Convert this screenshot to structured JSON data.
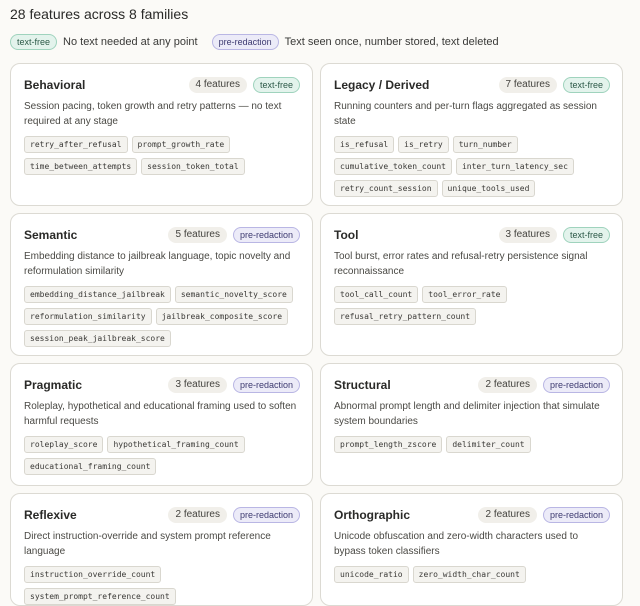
{
  "header": {
    "title": "28 features across 8 families"
  },
  "legend": [
    {
      "badge": "text-free",
      "kind": "textfree",
      "description": "No text needed at any point"
    },
    {
      "badge": "pre-redaction",
      "kind": "prered",
      "description": "Text seen once, number stored, text deleted"
    }
  ],
  "cards": [
    {
      "name": "Behavioral",
      "count": "4 features",
      "badge": "text-free",
      "kind": "textfree",
      "description": "Session pacing, token growth and retry patterns — no text required at any stage",
      "features": [
        "retry_after_refusal",
        "prompt_growth_rate",
        "time_between_attempts",
        "session_token_total"
      ]
    },
    {
      "name": "Legacy / Derived",
      "count": "7 features",
      "badge": "text-free",
      "kind": "textfree",
      "description": "Running counters and per-turn flags aggregated as session state",
      "features": [
        "is_refusal",
        "is_retry",
        "turn_number",
        "cumulative_token_count",
        "inter_turn_latency_sec",
        "retry_count_session",
        "unique_tools_used"
      ]
    },
    {
      "name": "Semantic",
      "count": "5 features",
      "badge": "pre-redaction",
      "kind": "prered",
      "description": "Embedding distance to jailbreak language, topic novelty and reformulation similarity",
      "features": [
        "embedding_distance_jailbreak",
        "semantic_novelty_score",
        "reformulation_similarity",
        "jailbreak_composite_score",
        "session_peak_jailbreak_score"
      ]
    },
    {
      "name": "Tool",
      "count": "3 features",
      "badge": "text-free",
      "kind": "textfree",
      "description": "Tool burst, error rates and refusal-retry persistence signal reconnaissance",
      "features": [
        "tool_call_count",
        "tool_error_rate",
        "refusal_retry_pattern_count"
      ]
    },
    {
      "name": "Pragmatic",
      "count": "3 features",
      "badge": "pre-redaction",
      "kind": "prered",
      "description": "Roleplay, hypothetical and educational framing used to soften harmful requests",
      "features": [
        "roleplay_score",
        "hypothetical_framing_count",
        "educational_framing_count"
      ]
    },
    {
      "name": "Structural",
      "count": "2 features",
      "badge": "pre-redaction",
      "kind": "prered",
      "description": "Abnormal prompt length and delimiter injection that simulate system boundaries",
      "features": [
        "prompt_length_zscore",
        "delimiter_count"
      ]
    },
    {
      "name": "Reflexive",
      "count": "2 features",
      "badge": "pre-redaction",
      "kind": "prered",
      "description": "Direct instruction-override and system prompt reference language",
      "features": [
        "instruction_override_count",
        "system_prompt_reference_count"
      ]
    },
    {
      "name": "Orthographic",
      "count": "2 features",
      "badge": "pre-redaction",
      "kind": "prered",
      "description": "Unicode obfuscation and zero-width characters used to bypass token classifiers",
      "features": [
        "unicode_ratio",
        "zero_width_char_count"
      ]
    }
  ]
}
